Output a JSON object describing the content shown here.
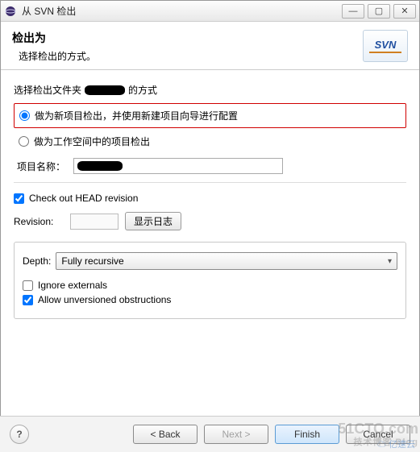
{
  "window": {
    "title": "从 SVN 检出"
  },
  "header": {
    "title": "检出为",
    "subtitle": "选择检出的方式。",
    "logo_text": "SVN"
  },
  "folder_mode": {
    "label_prefix": "选择检出文件夹",
    "label_suffix": "的方式",
    "option_new_project": "做为新项目检出，并使用新建项目向导进行配置",
    "option_workspace": "做为工作空间中的项目检出"
  },
  "project": {
    "label": "项目名称：",
    "value": ""
  },
  "revision": {
    "head_label": "Check out HEAD revision",
    "label": "Revision:",
    "value": "",
    "show_log": "显示日志"
  },
  "depth": {
    "label": "Depth:",
    "selected": "Fully recursive",
    "ignore_externals": "Ignore externals",
    "allow_unversioned": "Allow unversioned obstructions"
  },
  "buttons": {
    "back": "< Back",
    "next": "Next >",
    "finish": "Finish",
    "cancel": "Cancel"
  },
  "watermark": {
    "main": "51CTO.com",
    "sub": "技术博客 Blog",
    "cloud": "亿速云"
  }
}
